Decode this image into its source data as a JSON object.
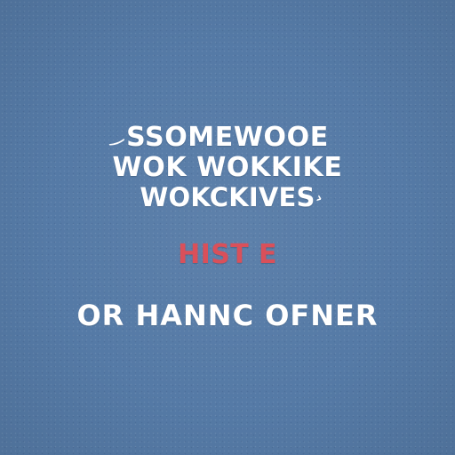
{
  "background_color": "#557aa6",
  "text_color": "#ffffff",
  "accent_color": "#d9505a",
  "lines": [
    "SSOMEWOOE",
    "WOK WOKKIKE",
    "WOKCKIVES",
    "HIST E",
    "OR HANNC OFNER"
  ],
  "marks": {
    "left": "‿",
    "right": "›"
  }
}
